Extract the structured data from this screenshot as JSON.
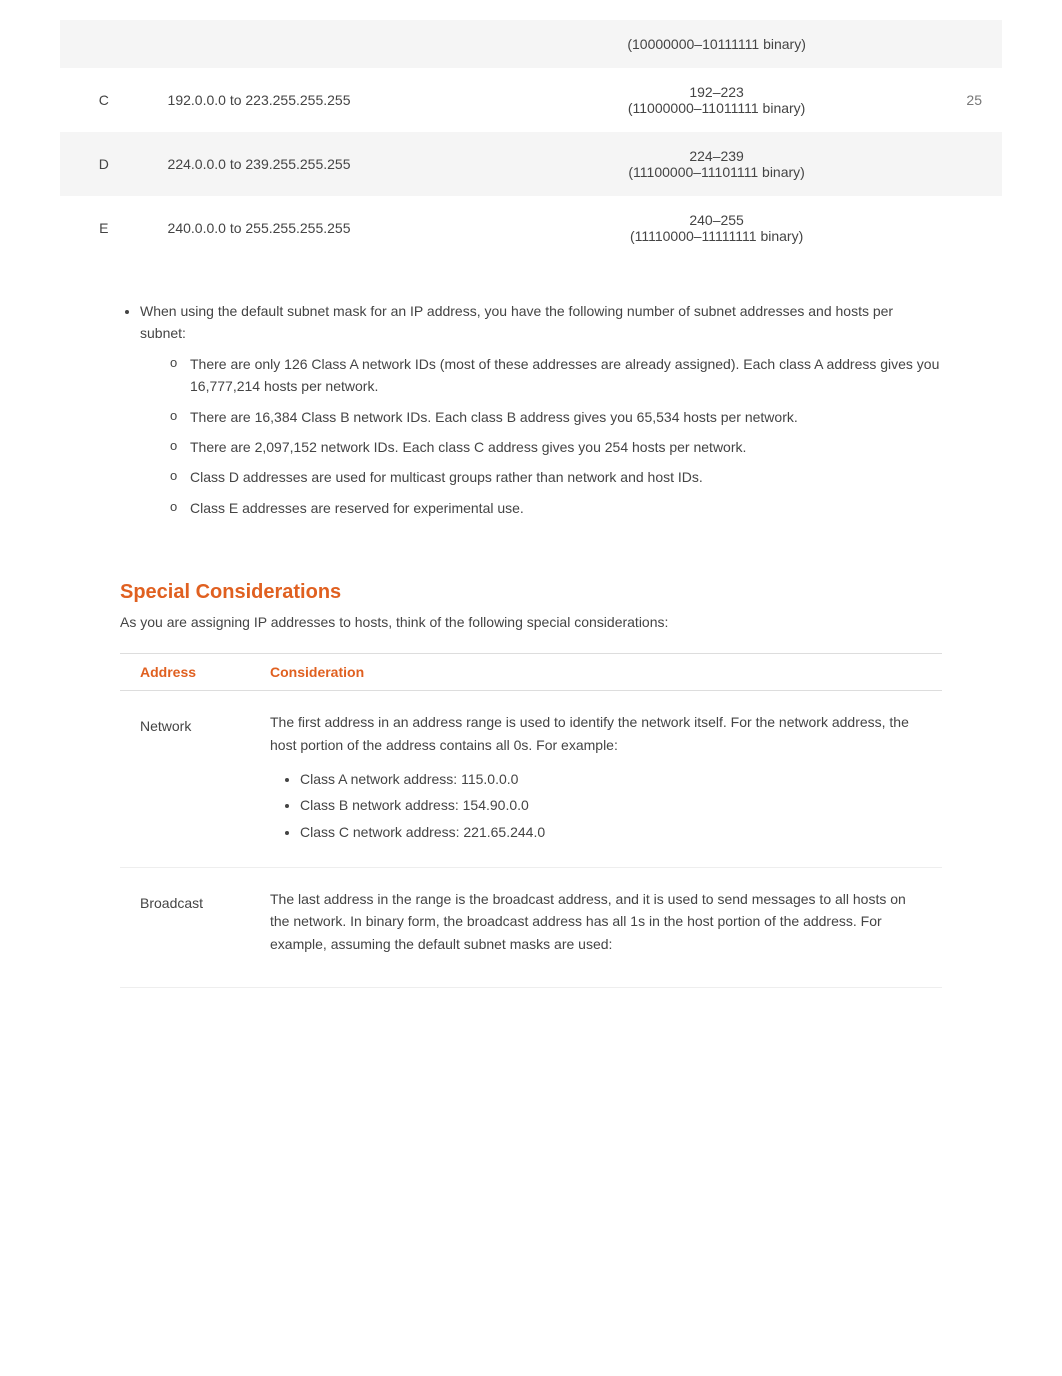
{
  "table": {
    "rows": [
      {
        "class": "C",
        "range": "192.0.0.0 to 223.255.255.255",
        "first_octet": "192–223",
        "binary": "(11000000–11011111 binary)",
        "page": "25"
      },
      {
        "class": "D",
        "range": "224.0.0.0 to 239.255.255.255",
        "first_octet": "224–239",
        "binary": "(11100000–11101111 binary)",
        "page": ""
      },
      {
        "class": "E",
        "range": "240.0.0.0 to 255.255.255.255",
        "first_octet": "240–255",
        "binary": "(11110000–11111111 binary)",
        "page": ""
      }
    ],
    "top_row": {
      "first_octet": "(10000000–10111111 binary)"
    }
  },
  "bullet_section": {
    "main_bullet": "When using the default subnet mask for an IP address, you have the following number of subnet addresses and hosts per subnet:",
    "sub_bullets": [
      "There are only 126 Class A network IDs (most of these addresses are already assigned). Each class A address gives you 16,777,214 hosts per network.",
      "There are 16,384 Class B network IDs. Each class B address gives you 65,534 hosts per network.",
      "There are 2,097,152 network IDs. Each class C address gives you 254 hosts per network.",
      "Class D addresses are used for multicast groups rather than network and host IDs.",
      "Class E addresses are reserved for experimental use."
    ]
  },
  "special_considerations": {
    "title": "Special Considerations",
    "intro": "As you are assigning IP addresses to hosts, think of the following special considerations:",
    "table_headers": {
      "address": "Address",
      "consideration": "Consideration"
    },
    "rows": [
      {
        "address": "Network",
        "description": "The first address in an address range is used to identify the network itself. For the network address, the host portion of the address contains all 0s. For example:",
        "bullets": [
          "Class A network address: 115.0.0.0",
          "Class B network address: 154.90.0.0",
          "Class C network address: 221.65.244.0"
        ]
      },
      {
        "address": "Broadcast",
        "description": "The last address in the range is the broadcast address, and it is used to send messages to all hosts on the network. In binary form, the broadcast address has all 1s in the host portion of the address. For example, assuming the default subnet masks are used:",
        "bullets": []
      }
    ]
  }
}
